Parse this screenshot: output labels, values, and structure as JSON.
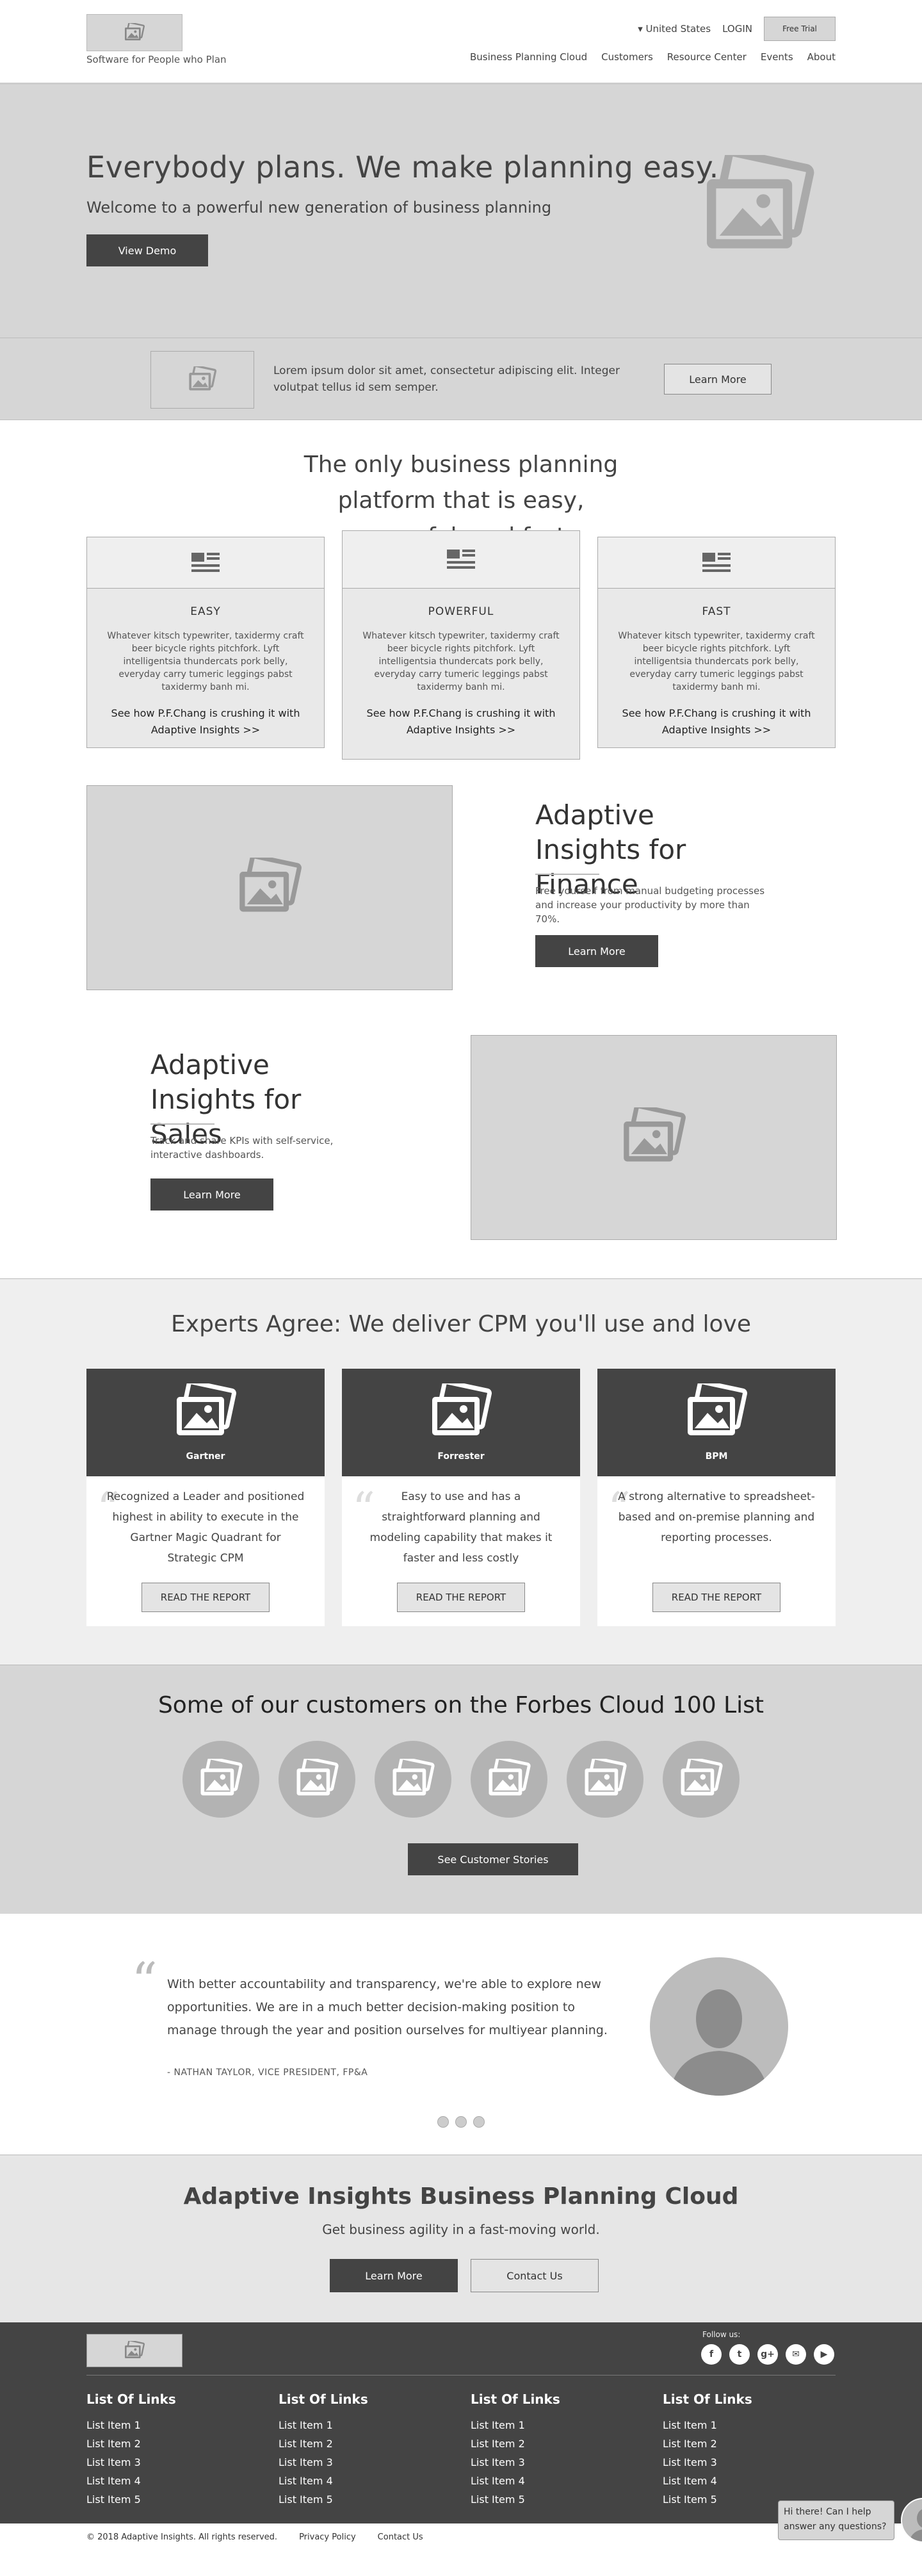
{
  "header": {
    "tagline": "Software for People who Plan",
    "country": "United States",
    "login": "LOGIN",
    "free_trial": "Free Trial",
    "nav": [
      "Business Planning Cloud",
      "Customers",
      "Resource Center",
      "Events",
      "About"
    ]
  },
  "hero": {
    "title": "Everybody plans. We make planning easy.",
    "subtitle": "Welcome to a powerful new generation of business planning",
    "cta": "View Demo"
  },
  "promo": {
    "text": "Lorem ipsum dolor sit amet, consectetur adipiscing elit. Integer volutpat tellus id sem semper.",
    "cta": "Learn More"
  },
  "platform": {
    "title": "The only business planning platform that is easy, powerful, and fast",
    "features": [
      {
        "title": "EASY",
        "body": "Whatever kitsch typewriter, taxidermy craft beer bicycle rights pitchfork. Lyft intelligentsia thundercats pork belly, everyday carry tumeric leggings pabst taxidermy banh mi.",
        "link": "See how P.F.Chang is crushing it with Adaptive Insights >>"
      },
      {
        "title": "POWERFUL",
        "body": "Whatever kitsch typewriter, taxidermy craft beer bicycle rights pitchfork. Lyft intelligentsia thundercats pork belly, everyday carry tumeric leggings pabst taxidermy banh mi.",
        "link": "See how P.F.Chang is crushing it with Adaptive Insights >>"
      },
      {
        "title": "FAST",
        "body": "Whatever kitsch typewriter, taxidermy craft beer bicycle rights pitchfork. Lyft intelligentsia thundercats pork belly, everyday carry tumeric leggings pabst taxidermy banh mi.",
        "link": "See how P.F.Chang is crushing it with Adaptive Insights >>"
      }
    ]
  },
  "finance": {
    "title": "Adaptive Insights for Finance",
    "body": "Free yourself from manual budgeting processes and increase your productivity by more than 70%.",
    "cta": "Learn More"
  },
  "sales": {
    "title": "Adaptive Insights for Sales",
    "body": "Track and share KPIs with self-service, interactive dashboards.",
    "cta": "Learn More"
  },
  "experts": {
    "title": "Experts Agree: We deliver CPM you'll use and love",
    "cards": [
      {
        "name": "Gartner",
        "text": "Recognized a Leader and positioned highest in ability to execute in the Gartner Magic Quadrant for Strategic CPM",
        "cta": "READ THE REPORT"
      },
      {
        "name": "Forrester",
        "text": "Easy to use and has a straightforward planning and modeling capability that makes it faster and less costly",
        "cta": "READ THE REPORT"
      },
      {
        "name": "BPM",
        "text": "A strong alternative to spreadsheet-based and on-premise planning and reporting processes.",
        "cta": "READ THE REPORT"
      }
    ]
  },
  "customers": {
    "title": "Some of our customers on the Forbes Cloud 100 List",
    "cta": "See Customer Stories"
  },
  "testimonial": {
    "quote": "With better accountability and transparency, we're able to explore new opportunities. We are in a much better decision-making position to manage through the year and position ourselves for multiyear planning.",
    "author": "- NATHAN TAYLOR, VICE PRESIDENT, FP&A"
  },
  "cta": {
    "title": "Adaptive Insights Business Planning Cloud",
    "subtitle": "Get business agility in a fast-moving world.",
    "primary": "Learn More",
    "secondary": "Contact Us"
  },
  "footer": {
    "follow_label": "Follow us:",
    "social_icons": [
      "facebook-icon",
      "twitter-icon",
      "google-plus-icon",
      "email-icon",
      "youtube-icon"
    ],
    "columns": [
      {
        "title": "List Of Links",
        "items": [
          "List Item 1",
          "List Item 2",
          "List Item 3",
          "List Item 4",
          "List Item 5"
        ]
      },
      {
        "title": "List Of Links",
        "items": [
          "List Item 1",
          "List Item 2",
          "List Item 3",
          "List Item 4",
          "List Item 5"
        ]
      },
      {
        "title": "List Of Links",
        "items": [
          "List Item 1",
          "List Item 2",
          "List Item 3",
          "List Item 4",
          "List Item 5"
        ]
      },
      {
        "title": "List Of Links",
        "items": [
          "List Item 1",
          "List Item 2",
          "List Item 3",
          "List Item 4",
          "List Item 5"
        ]
      }
    ],
    "copyright": "© 2018 Adaptive Insights. All rights reserved.",
    "privacy": "Privacy Policy",
    "contact": "Contact Us",
    "chat": "Hi there! Can I help answer any questions?"
  },
  "colors": {
    "placeholder_gray": "#d6d6d6",
    "dark": "#444444",
    "light": "#efefef"
  }
}
